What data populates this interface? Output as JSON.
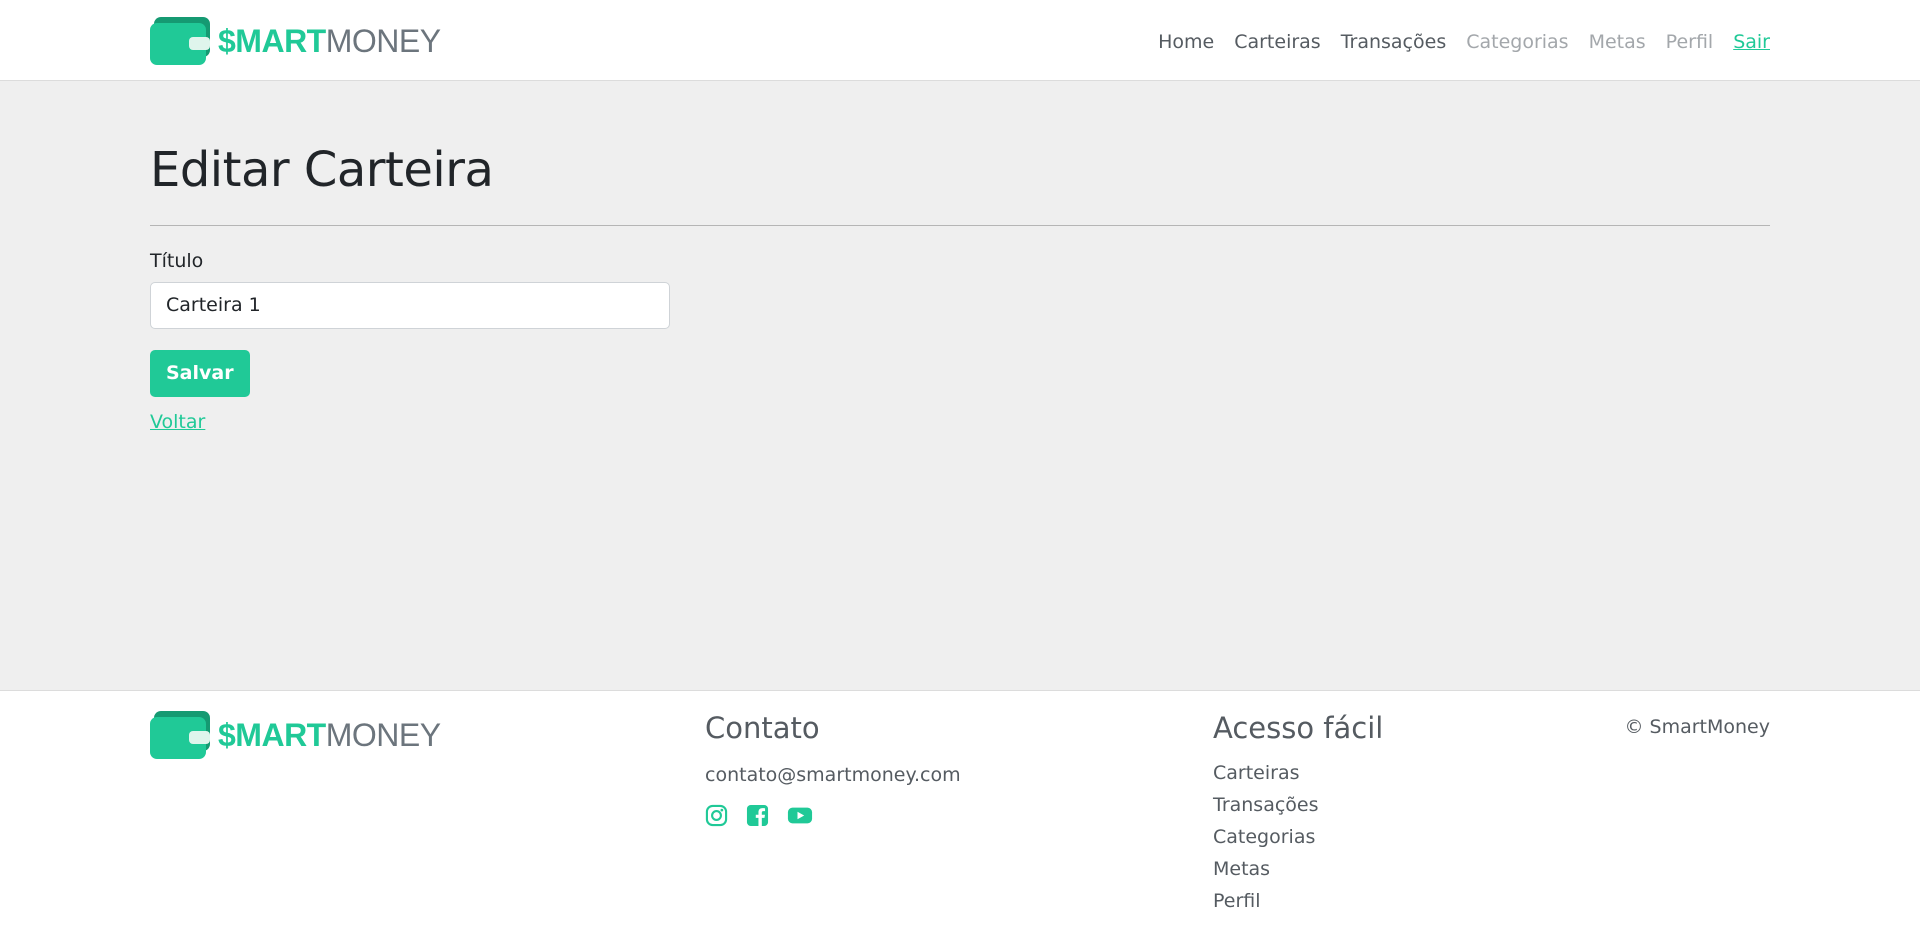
{
  "header": {
    "brand": {
      "smart": "$MART",
      "money": "MONEY"
    },
    "nav": [
      {
        "label": "Home",
        "state": "default"
      },
      {
        "label": "Carteiras",
        "state": "default"
      },
      {
        "label": "Transações",
        "state": "default"
      },
      {
        "label": "Categorias",
        "state": "muted"
      },
      {
        "label": "Metas",
        "state": "muted"
      },
      {
        "label": "Perfil",
        "state": "muted"
      },
      {
        "label": "Sair",
        "state": "accent"
      }
    ]
  },
  "main": {
    "title": "Editar Carteira",
    "form": {
      "title_label": "Título",
      "title_value": "Carteira 1",
      "save_label": "Salvar",
      "back_label": "Voltar"
    }
  },
  "footer": {
    "brand": {
      "smart": "$MART",
      "money": "MONEY"
    },
    "contact_heading": "Contato",
    "email": "contato@smartmoney.com",
    "social": [
      {
        "icon": "instagram-icon"
      },
      {
        "icon": "facebook-icon"
      },
      {
        "icon": "youtube-icon"
      }
    ],
    "links_heading": "Acesso fácil",
    "links": [
      "Carteiras",
      "Transações",
      "Categorias",
      "Metas",
      "Perfil"
    ],
    "copyright": "© SmartMoney"
  },
  "colors": {
    "accent": "#20c997",
    "accent_dark": "#159a72",
    "text_muted": "#a3a7ab",
    "text_nav": "#555b61",
    "page_background": "#efefef"
  }
}
